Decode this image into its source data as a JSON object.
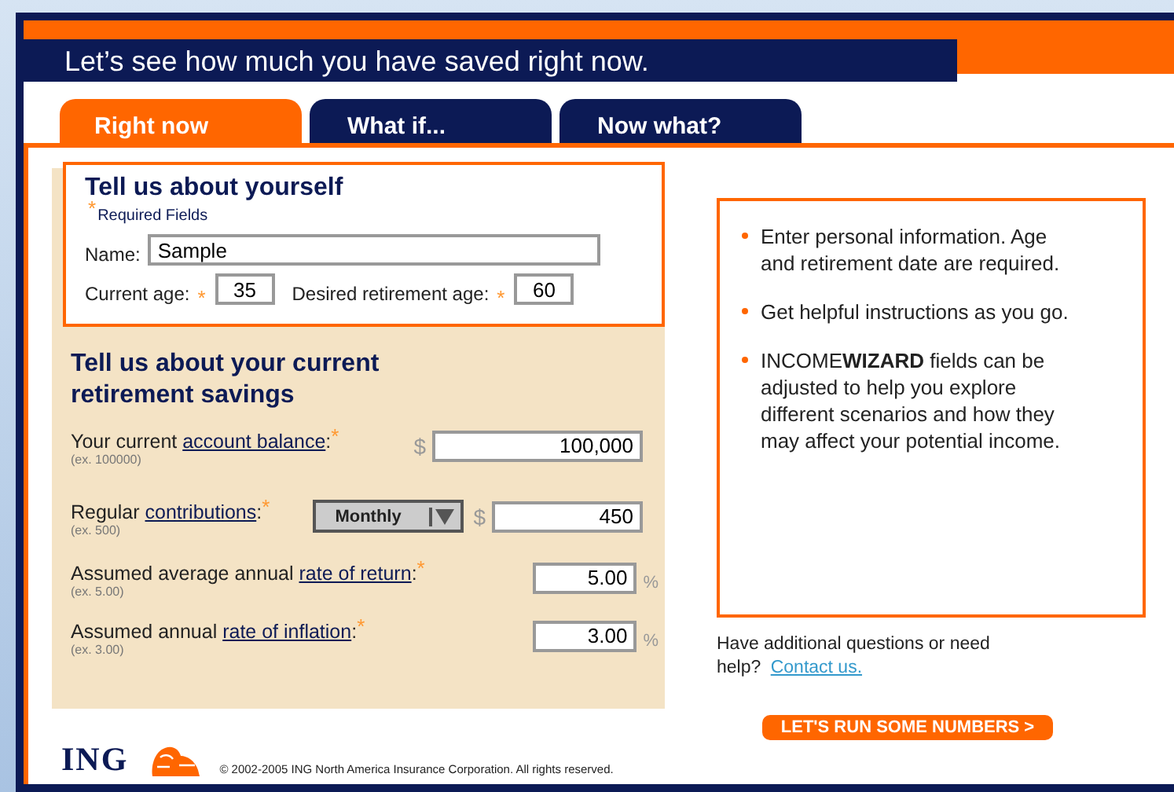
{
  "header": {
    "title": "Let’s see how much you have saved right now."
  },
  "tabs": [
    {
      "label": "Right now",
      "selected": true
    },
    {
      "label": "What if...",
      "selected": false
    },
    {
      "label": "Now what?",
      "selected": false
    }
  ],
  "about": {
    "title": "Tell us about yourself",
    "required_mark": "*",
    "required_note": "Required Fields",
    "name": {
      "label": "Name:",
      "value": "Sample"
    },
    "ages": [
      {
        "label": "Current age:",
        "mark": "*",
        "value": "35"
      },
      {
        "label": "Desired retirement age:",
        "mark": "*",
        "value": "60"
      }
    ]
  },
  "savings": {
    "title": "Tell us about your current retirement savings",
    "fields": [
      {
        "kind": "currency",
        "before": "Your current ",
        "link": "account balance",
        "after": ":",
        "mark": "*",
        "example": "(ex. 100000)",
        "prefix": "$",
        "value": "100,000"
      },
      {
        "kind": "periodic",
        "before": "Regular ",
        "link": "contributions",
        "after": ":",
        "mark": "*",
        "example": "(ex. 500)",
        "period": "Monthly",
        "prefix": "$",
        "value": "450"
      },
      {
        "kind": "percent",
        "before": "Assumed average annual ",
        "link": "rate of return",
        "after": ":",
        "mark": "*",
        "example": "(ex. 5.00)",
        "value": "5.00",
        "suffix": "%"
      },
      {
        "kind": "percent",
        "before": "Assumed annual ",
        "link": "rate of inflation",
        "after": ":",
        "mark": "*",
        "example": "(ex. 3.00)",
        "value": "3.00",
        "suffix": "%"
      }
    ]
  },
  "tips": [
    "Enter personal information. Age and retirement date are required.",
    "Get helpful instructions as you go.",
    "INCOME**WIZARD** fields can be adjusted to help you explore different scenarios and how they may affect your potential income."
  ],
  "help": {
    "text": "Have additional questions or need help?",
    "link": "Contact us."
  },
  "run_button": "LET'S RUN SOME NUMBERS >",
  "footer": {
    "logo": "ING",
    "copyright": "© 2002-2005 ING North America Insurance Corporation. All rights reserved."
  }
}
